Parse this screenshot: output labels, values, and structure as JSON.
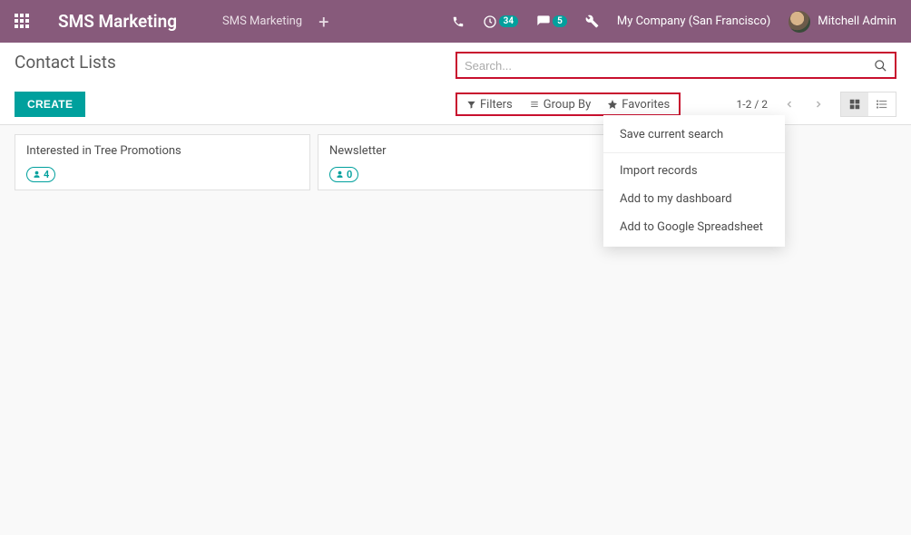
{
  "topbar": {
    "brand": "SMS Marketing",
    "nav_item": "SMS Marketing",
    "activities_count": "34",
    "messages_count": "5",
    "company": "My Company (San Francisco)",
    "user_name": "Mitchell Admin"
  },
  "page": {
    "title": "Contact Lists",
    "create_label": "CREATE",
    "search_placeholder": "Search..."
  },
  "toolbar": {
    "filters": "Filters",
    "group_by": "Group By",
    "favorites": "Favorites",
    "pager": "1-2 / 2"
  },
  "favorites_menu": {
    "save": "Save current search",
    "import": "Import records",
    "add_dashboard": "Add to my dashboard",
    "add_google": "Add to Google Spreadsheet"
  },
  "cards": [
    {
      "title": "Interested in Tree Promotions",
      "count": "4"
    },
    {
      "title": "Newsletter",
      "count": "0"
    }
  ]
}
